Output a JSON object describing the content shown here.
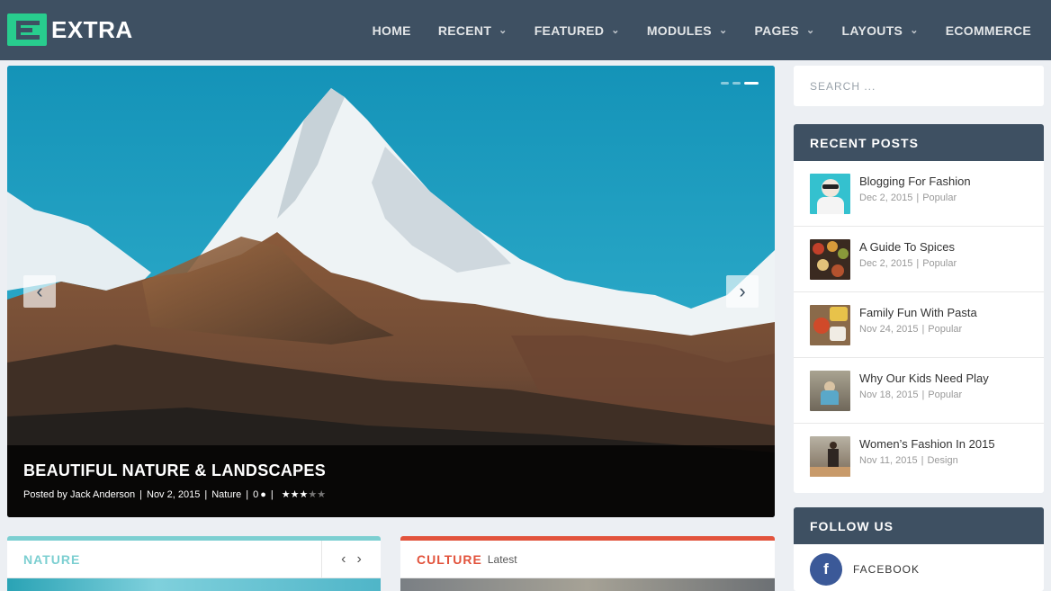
{
  "site": {
    "logo_text": "EXTRA",
    "brand_color": "#28cd8e",
    "header_color": "#3e5062"
  },
  "nav": [
    {
      "label": "HOME",
      "has_dropdown": false
    },
    {
      "label": "RECENT",
      "has_dropdown": true
    },
    {
      "label": "FEATURED",
      "has_dropdown": true
    },
    {
      "label": "MODULES",
      "has_dropdown": true
    },
    {
      "label": "PAGES",
      "has_dropdown": true
    },
    {
      "label": "LAYOUTS",
      "has_dropdown": true
    },
    {
      "label": "ECOMMERCE",
      "has_dropdown": false
    }
  ],
  "slider": {
    "title": "BEAUTIFUL NATURE & LANDSCAPES",
    "posted_by_prefix": "Posted by",
    "author": "Jack Anderson",
    "date": "Nov 2, 2015",
    "category": "Nature",
    "comments": "0",
    "rating": 2.5,
    "rating_max": 5,
    "slide_count": 3,
    "active_slide": 3
  },
  "modules": {
    "nature": {
      "title": "NATURE",
      "accent": "#7ccfd1"
    },
    "culture": {
      "title": "CULTURE",
      "subtitle": "Latest",
      "accent": "#e2533c"
    }
  },
  "search": {
    "placeholder": "SEARCH ..."
  },
  "recent_posts": {
    "title": "RECENT POSTS",
    "items": [
      {
        "title": "Blogging For Fashion",
        "date": "Dec 2, 2015",
        "category": "Popular"
      },
      {
        "title": "A Guide To Spices",
        "date": "Dec 2, 2015",
        "category": "Popular"
      },
      {
        "title": "Family Fun With Pasta",
        "date": "Nov 24, 2015",
        "category": "Popular"
      },
      {
        "title": "Why Our Kids Need Play",
        "date": "Nov 18, 2015",
        "category": "Popular"
      },
      {
        "title": "Women’s Fashion In 2015",
        "date": "Nov 11, 2015",
        "category": "Design"
      }
    ]
  },
  "follow_us": {
    "title": "FOLLOW US",
    "networks": [
      {
        "label": "FACEBOOK",
        "icon": "facebook-icon",
        "color": "#3b5998"
      }
    ]
  }
}
